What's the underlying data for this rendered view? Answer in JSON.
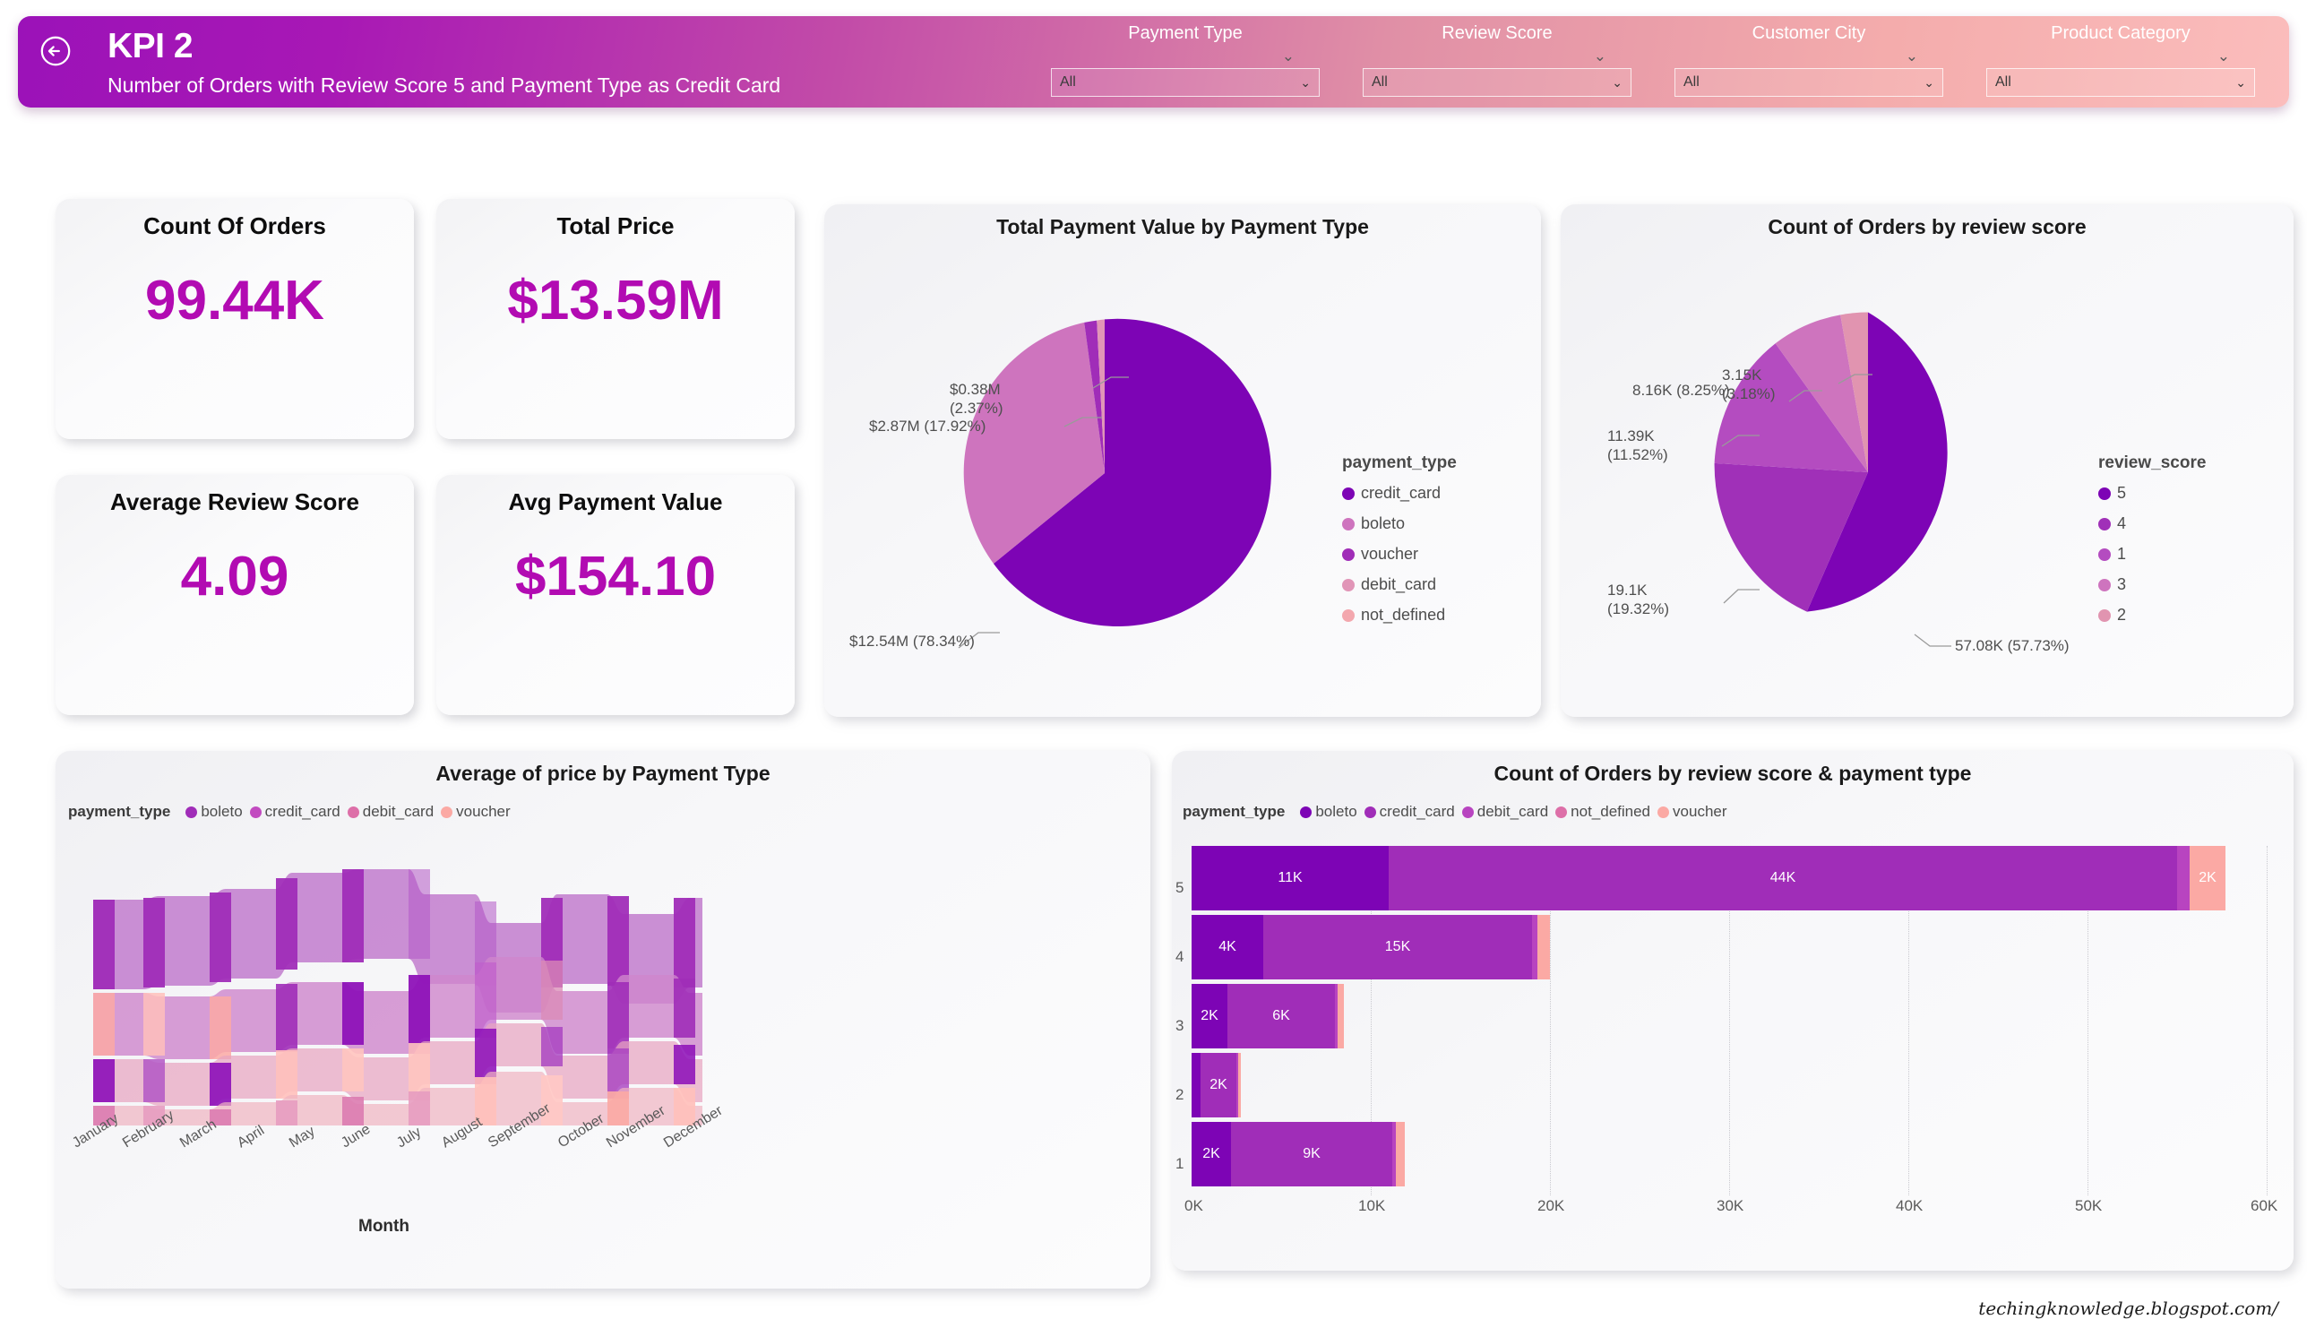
{
  "header": {
    "back_icon": "circle-arrow-left-icon",
    "title": "KPI 2",
    "subtitle": "Number of Orders with Review Score 5 and Payment Type as Credit Card"
  },
  "filters": [
    {
      "label": "Payment Type",
      "value": "All",
      "chevron": "⌄"
    },
    {
      "label": "Review Score",
      "value": "All",
      "chevron": "⌄"
    },
    {
      "label": "Customer City",
      "value": "All",
      "chevron": "⌄"
    },
    {
      "label": "Product Category",
      "value": "All",
      "chevron": "⌄"
    }
  ],
  "kpi_cards": [
    {
      "title": "Count Of Orders",
      "value": "99.44K"
    },
    {
      "title": "Total Price",
      "value": "$13.59M"
    },
    {
      "title": "Average Review Score",
      "value": "4.09"
    },
    {
      "title": "Avg Payment Value",
      "value": "$154.10"
    }
  ],
  "colors": {
    "accent": "#B20BB2",
    "deep_purple": "#7D04B5",
    "purple": "#A02DB8",
    "mid_purple": "#B44CC0",
    "orchid": "#C96FC0",
    "pink": "#DB8BB5",
    "rose": "#E79CB0",
    "salmon": "#FBA9A4",
    "light_salmon": "#FFC0BB",
    "header_start": "#9B12B8",
    "header_end": "#FBBDBC"
  },
  "chart_data": [
    {
      "id": "payment-value-pie",
      "type": "pie",
      "title": "Total Payment Value by Payment Type",
      "legend_title": "payment_type",
      "legend_position": "right",
      "categories": [
        "credit_card",
        "boleto",
        "voucher",
        "debit_card",
        "not_defined"
      ],
      "values": [
        78.34,
        17.92,
        2.37,
        1.37,
        0.0
      ],
      "labels": [
        "$12.54M (78.34%)",
        "$2.87M (17.92%)",
        "$0.38M (2.37%)"
      ],
      "callouts": [
        {
          "text": "$0.38M\n(2.37%)"
        },
        {
          "text": "$2.87M (17.92%)"
        },
        {
          "text": "$12.54M (78.34%)"
        }
      ],
      "colors": [
        "#7D04B5",
        "#CE74BE",
        "#A02DB8",
        "#E195B7",
        "#F3A7AE"
      ]
    },
    {
      "id": "orders-review-pie",
      "type": "pie",
      "title": "Count of Orders by review score",
      "legend_title": "review_score",
      "legend_position": "right",
      "categories": [
        "5",
        "4",
        "1",
        "3",
        "2"
      ],
      "values": [
        57.73,
        19.32,
        11.52,
        8.25,
        3.18
      ],
      "counts": [
        "57.08K",
        "19.1K",
        "11.39K",
        "8.16K",
        "3.15K"
      ],
      "labels": [
        "57.08K (57.73%)",
        "19.1K (19.32%)",
        "11.39K (11.52%)",
        "8.16K (8.25%)",
        "3.15K (3.18%)"
      ],
      "colors": [
        "#7D04B5",
        "#A030B8",
        "#B44CC0",
        "#CE74BE",
        "#E194B0"
      ]
    },
    {
      "id": "avg-price-ribbon",
      "type": "area",
      "title": "Average of price by Payment Type",
      "legend_title": "payment_type",
      "legend": [
        "boleto",
        "credit_card",
        "debit_card",
        "voucher"
      ],
      "legend_colors": [
        "#A02DB8",
        "#C24BC0",
        "#DD6FA8",
        "#FBA9A4"
      ],
      "xlabel": "Month",
      "categories": [
        "January",
        "February",
        "March",
        "April",
        "May",
        "June",
        "July",
        "August",
        "September",
        "October",
        "November",
        "December"
      ],
      "series": [
        {
          "name": "boleto",
          "values": [
            4,
            4,
            4,
            3,
            3,
            2,
            2,
            1,
            1,
            2,
            2,
            2
          ]
        },
        {
          "name": "credit_card",
          "values": [
            3,
            3,
            3,
            4,
            4,
            3,
            3,
            2,
            3,
            3,
            3,
            3
          ]
        },
        {
          "name": "debit_card",
          "values": [
            2,
            2,
            2,
            2,
            2,
            4,
            4,
            4,
            4,
            1,
            1,
            1
          ]
        },
        {
          "name": "voucher",
          "values": [
            1,
            1,
            1,
            1,
            1,
            1,
            1,
            3,
            2,
            4,
            4,
            4
          ]
        }
      ]
    },
    {
      "id": "orders-score-payment-bar",
      "type": "bar",
      "orientation": "horizontal",
      "stacked": true,
      "title": "Count of Orders by review score & payment type",
      "legend_title": "payment_type",
      "legend": [
        "boleto",
        "credit_card",
        "debit_card",
        "not_defined",
        "voucher"
      ],
      "legend_colors": [
        "#7D04B5",
        "#A02DB8",
        "#B844C0",
        "#DD6FA8",
        "#FBA9A4"
      ],
      "categories": [
        "5",
        "4",
        "3",
        "2",
        "1"
      ],
      "xlim": [
        0,
        60000
      ],
      "xticks": [
        "0K",
        "10K",
        "20K",
        "30K",
        "40K",
        "50K",
        "60K"
      ],
      "rows": [
        {
          "category": "5",
          "segments": [
            {
              "name": "boleto",
              "value": 11000,
              "label": "11K"
            },
            {
              "name": "credit_card",
              "value": 44000,
              "label": "44K"
            },
            {
              "name": "debit_card",
              "value": 700,
              "label": ""
            },
            {
              "name": "voucher",
              "value": 2000,
              "label": "2K"
            }
          ]
        },
        {
          "category": "4",
          "segments": [
            {
              "name": "boleto",
              "value": 4000,
              "label": "4K"
            },
            {
              "name": "credit_card",
              "value": 15000,
              "label": "15K"
            },
            {
              "name": "debit_card",
              "value": 300,
              "label": ""
            },
            {
              "name": "voucher",
              "value": 700,
              "label": ""
            }
          ]
        },
        {
          "category": "3",
          "segments": [
            {
              "name": "boleto",
              "value": 2000,
              "label": "2K"
            },
            {
              "name": "credit_card",
              "value": 6000,
              "label": "6K"
            },
            {
              "name": "debit_card",
              "value": 150,
              "label": ""
            },
            {
              "name": "voucher",
              "value": 350,
              "label": ""
            }
          ]
        },
        {
          "category": "2",
          "segments": [
            {
              "name": "boleto",
              "value": 500,
              "label": ""
            },
            {
              "name": "credit_card",
              "value": 2000,
              "label": "2K"
            },
            {
              "name": "debit_card",
              "value": 80,
              "label": ""
            },
            {
              "name": "voucher",
              "value": 150,
              "label": ""
            }
          ]
        },
        {
          "category": "1",
          "segments": [
            {
              "name": "boleto",
              "value": 2000,
              "label": "2K"
            },
            {
              "name": "credit_card",
              "value": 9000,
              "label": "9K"
            },
            {
              "name": "debit_card",
              "value": 200,
              "label": ""
            },
            {
              "name": "voucher",
              "value": 500,
              "label": ""
            }
          ]
        }
      ]
    }
  ],
  "watermark": "techingknowledge.blogspot.com/"
}
